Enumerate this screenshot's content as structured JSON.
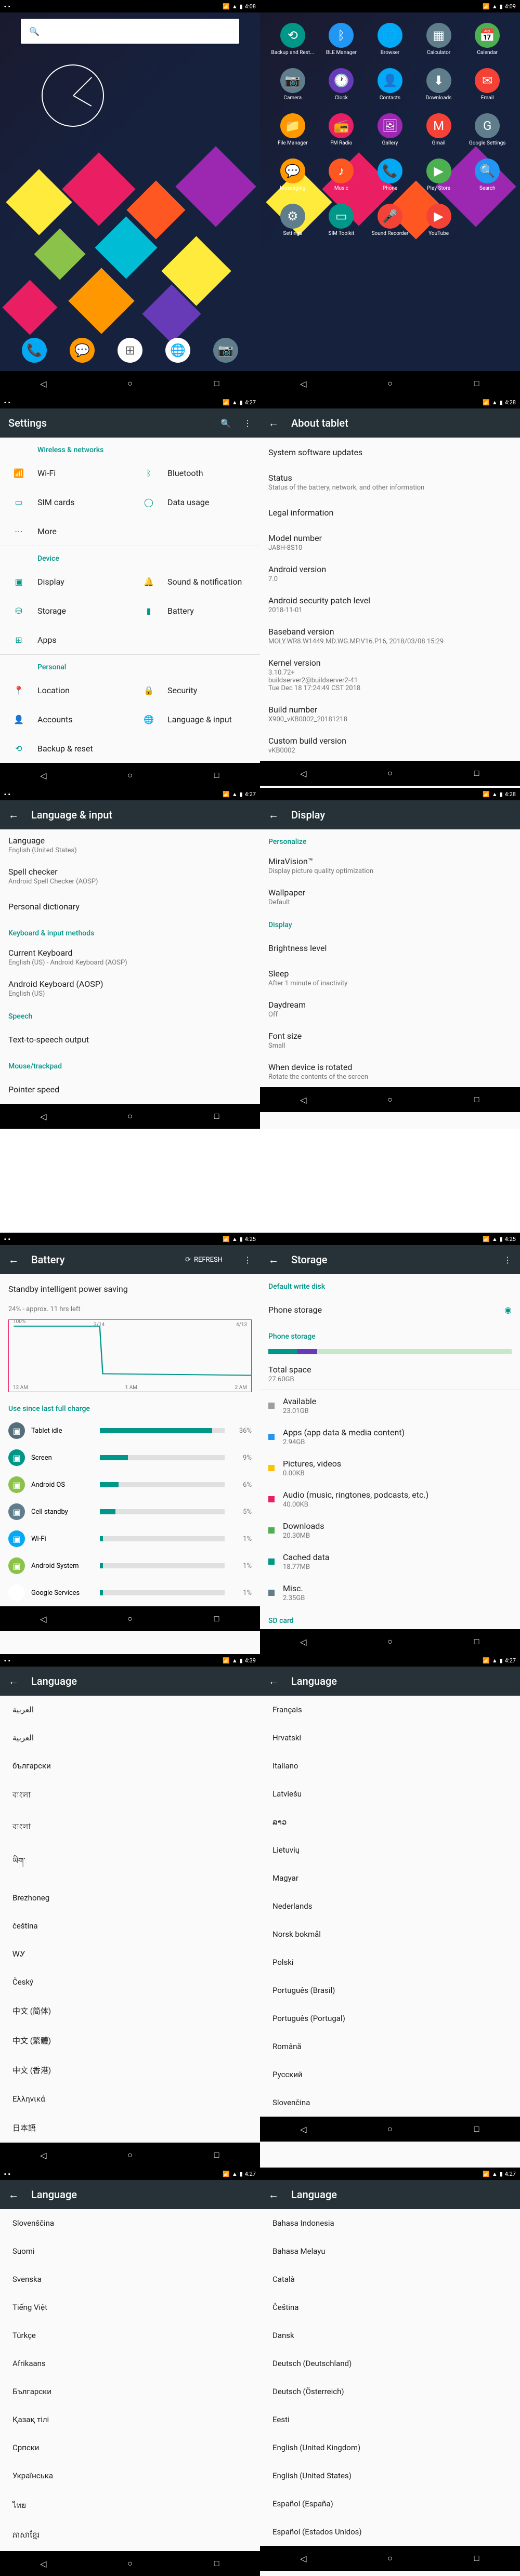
{
  "time1": "4:08",
  "time2": "4:09",
  "time3": "4:27",
  "time4": "4:28",
  "time5": "4:25",
  "time6": "4:39",
  "home": {
    "dock": [
      "Phone",
      "Messaging",
      "Apps",
      "Chrome",
      "Camera"
    ]
  },
  "apps": {
    "items": [
      {
        "label": "Backup and Rest..."
      },
      {
        "label": "BLE Manager"
      },
      {
        "label": "Browser"
      },
      {
        "label": "Calculator"
      },
      {
        "label": "Calendar"
      },
      {
        "label": "Camera"
      },
      {
        "label": "Clock"
      },
      {
        "label": "Contacts"
      },
      {
        "label": "Downloads"
      },
      {
        "label": "Email"
      },
      {
        "label": "File Manager"
      },
      {
        "label": "FM Radio"
      },
      {
        "label": "Gallery"
      },
      {
        "label": "Gmail"
      },
      {
        "label": "Google Settings"
      },
      {
        "label": "Messaging"
      },
      {
        "label": "Music"
      },
      {
        "label": "Phone"
      },
      {
        "label": "Play Store"
      },
      {
        "label": "Search"
      },
      {
        "label": "Settings"
      },
      {
        "label": "SIM Toolkit"
      },
      {
        "label": "Sound Recorder"
      },
      {
        "label": "YouTube"
      }
    ]
  },
  "settings": {
    "title": "Settings",
    "sections": {
      "wireless": "Wireless & networks",
      "device": "Device",
      "personal": "Personal"
    },
    "items": {
      "wifi": "Wi-Fi",
      "bluetooth": "Bluetooth",
      "simcards": "SIM cards",
      "datausage": "Data usage",
      "more": "More",
      "display": "Display",
      "sound": "Sound & notification",
      "storage": "Storage",
      "battery": "Battery",
      "apps": "Apps",
      "location": "Location",
      "security": "Security",
      "accounts": "Accounts",
      "language": "Language & input",
      "backup": "Backup & reset"
    }
  },
  "about": {
    "title": "About tablet",
    "updates": "System software updates",
    "status": {
      "t": "Status",
      "s": "Status of the battery, network, and other information"
    },
    "legal": "Legal information",
    "model": {
      "t": "Model number",
      "s": "JA8H-8S10"
    },
    "android": {
      "t": "Android version",
      "s": "7.0"
    },
    "patch": {
      "t": "Android security patch level",
      "s": "2018-11-01"
    },
    "baseband": {
      "t": "Baseband version",
      "s": "MOLY.WR8.W1449.MD.WG.MP.V16.P16, 2018/03/08 15:29"
    },
    "kernel": {
      "t": "Kernel version",
      "s": "3.10.72+\nbuildserver2@buildserver2-41\nTue Dec 18 17:24:49 CST 2018"
    },
    "build": {
      "t": "Build number",
      "s": "X900_vKB0002_20181218"
    },
    "custom": {
      "t": "Custom build version",
      "s": "vKB0002"
    }
  },
  "langInput": {
    "title": "Language & input",
    "language": {
      "t": "Language",
      "s": "English (United States)"
    },
    "spell": {
      "t": "Spell checker",
      "s": "Android Spell Checker (AOSP)"
    },
    "dict": "Personal dictionary",
    "kbHeader": "Keyboard & input methods",
    "current": {
      "t": "Current Keyboard",
      "s": "English (US) - Android Keyboard (AOSP)"
    },
    "android": {
      "t": "Android Keyboard (AOSP)",
      "s": "English (US)"
    },
    "speechHeader": "Speech",
    "tts": "Text-to-speech output",
    "mouseHeader": "Mouse/trackpad",
    "pointer": "Pointer speed"
  },
  "display": {
    "title": "Display",
    "personalize": "Personalize",
    "mira": {
      "t": "MiraVision™",
      "s": "Display picture quality optimization"
    },
    "wallpaper": {
      "t": "Wallpaper",
      "s": "Default"
    },
    "dispHeader": "Display",
    "brightness": "Brightness level",
    "sleep": {
      "t": "Sleep",
      "s": "After 1 minute of inactivity"
    },
    "daydream": {
      "t": "Daydream",
      "s": "Off"
    },
    "fontsize": {
      "t": "Font size",
      "s": "Small"
    },
    "rotate": {
      "t": "When device is rotated",
      "s": "Rotate the contents of the screen"
    }
  },
  "battery": {
    "title": "Battery",
    "refresh": "REFRESH",
    "saving": "Standby intelligent power saving",
    "remaining": "24% - approx. 11 hrs left",
    "dates": {
      "d1": "3/14",
      "d2": "4/13"
    },
    "axis": {
      "t0": "12 AM",
      "t1": "1 AM",
      "t2": "2 AM"
    },
    "lastcharge": "Use since last full charge",
    "items": [
      {
        "label": "Tablet idle",
        "pct": "36%",
        "color": "#546e7a"
      },
      {
        "label": "Screen",
        "pct": "9%",
        "color": "#009688"
      },
      {
        "label": "Android OS",
        "pct": "6%",
        "color": "#8bc34a"
      },
      {
        "label": "Cell standby",
        "pct": "5%",
        "color": "#607d8b"
      },
      {
        "label": "Wi-Fi",
        "pct": "1%",
        "color": "#03a9f4"
      },
      {
        "label": "Android System",
        "pct": "1%",
        "color": "#8bc34a"
      },
      {
        "label": "Google Services",
        "pct": "1%",
        "color": "#ffffff"
      }
    ]
  },
  "storage": {
    "title": "Storage",
    "defaultDisk": "Default write disk",
    "phone": "Phone storage",
    "phoneHeader": "Phone storage",
    "total": {
      "t": "Total space",
      "s": "27.60GB"
    },
    "items": [
      {
        "t": "Available",
        "s": "23.01GB"
      },
      {
        "t": "Apps (app data & media content)",
        "s": "2.94GB"
      },
      {
        "t": "Pictures, videos",
        "s": "0.00KB"
      },
      {
        "t": "Audio (music, ringtones, podcasts, etc.)",
        "s": "40.00KB"
      },
      {
        "t": "Downloads",
        "s": "20.30MB"
      },
      {
        "t": "Cached data",
        "s": "18.77MB"
      },
      {
        "t": "Misc.",
        "s": "2.35GB"
      }
    ],
    "sd": "SD card"
  },
  "lang1": {
    "title": "Language",
    "items": [
      "العربية",
      "العربية",
      "български",
      "বাংলা",
      "বাংলা",
      "ཡིག་",
      "Brezhoneg",
      "čeština",
      "ᎳᎩ",
      "Český",
      "中文 (简体)",
      "中文 (繁體)",
      "中文 (香港)",
      "Ελληνικά",
      "日本語"
    ]
  },
  "lang2": {
    "title": "Language",
    "items": [
      "Français",
      "Hrvatski",
      "Italiano",
      "Latviešu",
      "ລາວ",
      "Lietuvių",
      "Magyar",
      "Nederlands",
      "Norsk bokmål",
      "Polski",
      "Português (Brasil)",
      "Português (Portugal)",
      "Română",
      "Русский",
      "Slovenčina"
    ]
  },
  "lang3": {
    "title": "Language",
    "items": [
      "Slovenščina",
      "Suomi",
      "Svenska",
      "Tiếng Việt",
      "Türkçe",
      "Afrikaans",
      "Български",
      "Қазақ тілі",
      "Српски",
      "Українська",
      "ไทย",
      "ភាសាខ្មែរ"
    ]
  },
  "lang4": {
    "title": "Language",
    "items": [
      "Bahasa Indonesia",
      "Bahasa Melayu",
      "Català",
      "Čeština",
      "Dansk",
      "Deutsch (Deutschland)",
      "Deutsch (Österreich)",
      "Eesti",
      "English (United Kingdom)",
      "English (United States)",
      "Español (España)",
      "Español (Estados Unidos)"
    ]
  }
}
